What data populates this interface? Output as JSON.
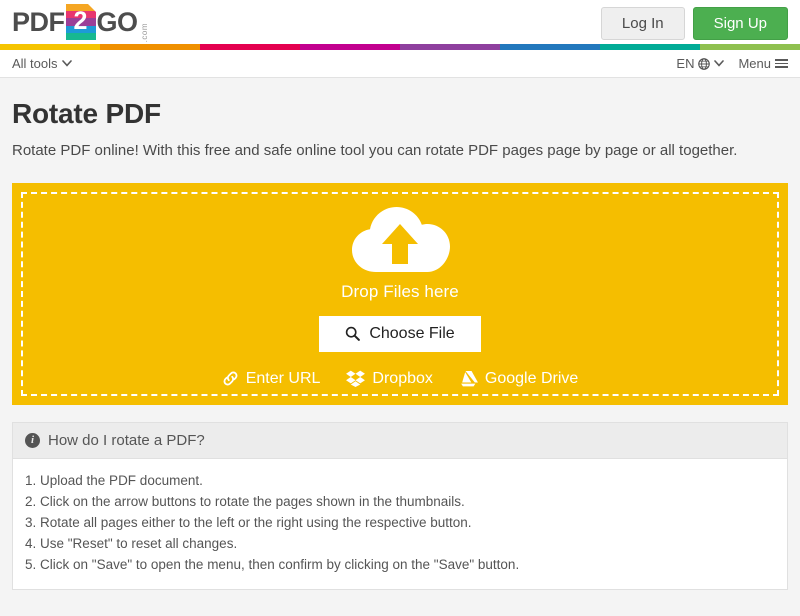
{
  "brand": {
    "name_part1": "PDF",
    "mark_digit": "2",
    "name_part2": "GO",
    "dotcom": ".com",
    "logo_bands": [
      "#f5a623",
      "#e8366f",
      "#9b3f98",
      "#1d9ad6",
      "#17b890"
    ]
  },
  "header": {
    "login_label": "Log In",
    "signup_label": "Sign Up",
    "signup_color": "#4caf50"
  },
  "stripe": {
    "colors": [
      "#f5c400",
      "#ef9000",
      "#e4004f",
      "#c2008f",
      "#8e3f9e",
      "#2278bd",
      "#00ab96",
      "#8fc04f"
    ]
  },
  "nav": {
    "all_tools_label": "All tools",
    "language_label": "EN",
    "menu_label": "Menu"
  },
  "page": {
    "title": "Rotate PDF",
    "description": "Rotate PDF online! With this free and safe online tool you can rotate PDF pages page by page or all together."
  },
  "dropzone": {
    "background": "#f5be00",
    "drop_label": "Drop Files here",
    "choose_file_label": "Choose File",
    "sources": [
      {
        "label": "Enter URL",
        "icon": "link-icon"
      },
      {
        "label": "Dropbox",
        "icon": "dropbox-icon"
      },
      {
        "label": "Google Drive",
        "icon": "google-drive-icon"
      }
    ]
  },
  "help": {
    "title": "How do I rotate a PDF?",
    "steps": [
      "1. Upload the PDF document.",
      "2. Click on the arrow buttons to rotate the pages shown in the thumbnails.",
      "3. Rotate all pages either to the left or the right using the respective button.",
      "4. Use \"Reset\" to reset all changes.",
      "5. Click on \"Save\" to open the menu, then confirm by clicking on the \"Save\" button."
    ]
  }
}
